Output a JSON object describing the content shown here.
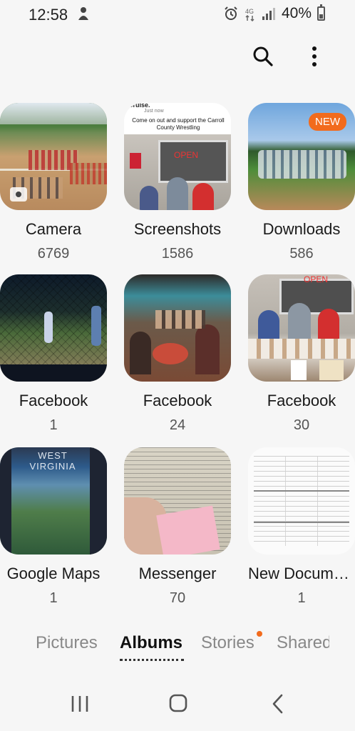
{
  "status_bar": {
    "time": "12:58",
    "battery": "40%",
    "battery_level": 0.4
  },
  "header": {
    "search_icon": "search-icon",
    "more_icon": "more-vertical-icon"
  },
  "albums": [
    {
      "name": "Camera",
      "count": "6769"
    },
    {
      "name": "Screenshots",
      "count": "1586",
      "preview_text": "Come on out and support the Carroll County Wrestling",
      "preview_header": "Cruise.",
      "preview_sub": "Just now"
    },
    {
      "name": "Downloads",
      "count": "586",
      "badge": "NEW"
    },
    {
      "name": "Facebook",
      "count": "1"
    },
    {
      "name": "Facebook",
      "count": "24"
    },
    {
      "name": "Facebook",
      "count": "30"
    },
    {
      "name": "Google Maps",
      "count": "1",
      "preview_title": "WEST VIRGINIA"
    },
    {
      "name": "Messenger",
      "count": "70"
    },
    {
      "name": "New Docume...",
      "count": "1"
    }
  ],
  "tabs": [
    {
      "label": "Pictures"
    },
    {
      "label": "Albums"
    },
    {
      "label": "Stories"
    },
    {
      "label": "Shared"
    }
  ],
  "accent_color": "#f26b1d"
}
